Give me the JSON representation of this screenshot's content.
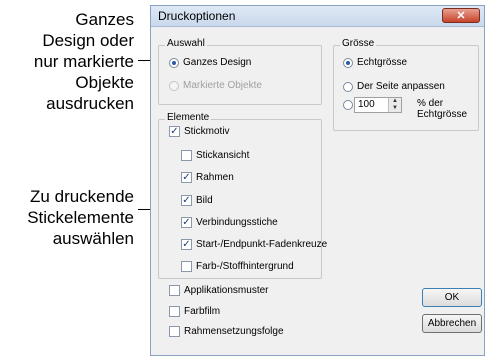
{
  "callouts": {
    "top": [
      "Ganzes",
      "Design oder",
      "nur markierte",
      "Objekte",
      "ausdrucken"
    ],
    "bottom": [
      "Zu druckende",
      "Stickelemente",
      "auswählen"
    ]
  },
  "dialog": {
    "title": "Druckoptionen",
    "close": "✕",
    "auswahl": {
      "legend": "Auswahl",
      "options": [
        {
          "label": "Ganzes Design",
          "selected": true,
          "enabled": true
        },
        {
          "label": "Markierte Objekte",
          "selected": false,
          "enabled": false
        }
      ]
    },
    "groesse": {
      "legend": "Grösse",
      "options": [
        {
          "label": "Echtgrösse",
          "selected": true
        },
        {
          "label": "Der Seite anpassen",
          "selected": false
        }
      ],
      "percent_value": "100",
      "percent_unit": [
        "% der",
        "Echtgrösse"
      ]
    },
    "elemente": {
      "legend": "Elemente",
      "items": [
        {
          "label": "Stickmotiv",
          "checked": true
        },
        {
          "label": "Stickansicht",
          "checked": false
        },
        {
          "label": "Rahmen",
          "checked": true
        },
        {
          "label": "Bild",
          "checked": true
        },
        {
          "label": "Verbindungsstiche",
          "checked": true
        },
        {
          "label": "Start-/Endpunkt-Fadenkreuze",
          "checked": true
        },
        {
          "label": "Farb-/Stoffhintergrund",
          "checked": false
        }
      ]
    },
    "extra": [
      {
        "label": "Applikationsmuster",
        "checked": false
      },
      {
        "label": "Farbfilm",
        "checked": false
      },
      {
        "label": "Rahmensetzungsfolge",
        "checked": false
      }
    ],
    "buttons": {
      "ok": "OK",
      "cancel": "Abbrechen"
    }
  }
}
